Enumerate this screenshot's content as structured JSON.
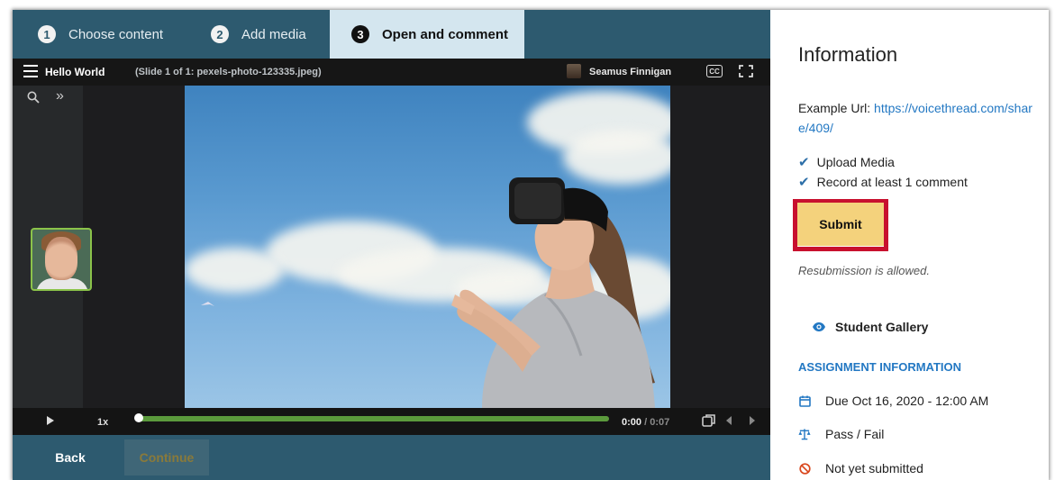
{
  "steps": [
    {
      "number": "1",
      "label": "Choose content"
    },
    {
      "number": "2",
      "label": "Add media"
    },
    {
      "number": "3",
      "label": "Open and comment"
    }
  ],
  "player": {
    "title": "Hello World",
    "slide_info": "(Slide 1 of 1: pexels-photo-123335.jpeg)",
    "owner_name": "Seamus Finnigan",
    "cc_label": "CC",
    "speed": "1x",
    "time_current": "0:00",
    "time_total": "/ 0:07",
    "progress": 1.0
  },
  "nav": {
    "back_label": "Back",
    "continue_label": "Continue"
  },
  "info": {
    "title": "Information",
    "url_label": "Example Url:",
    "url": "https://voicethread.com/share/409/",
    "requirements": [
      "Upload Media",
      "Record at least 1 comment"
    ],
    "submit_label": "Submit",
    "resubmission": "Resubmission is allowed.",
    "gallery_label": "Student Gallery",
    "assignment_heading": "ASSIGNMENT INFORMATION",
    "due": "Due Oct 16, 2020 - 12:00 AM",
    "grading": "Pass / Fail",
    "status": "Not yet submitted"
  },
  "colors": {
    "header_bg": "#2d5a6f",
    "active_step_bg": "#d4e6ef",
    "link": "#2378c3",
    "submit_bg": "#f4d27c",
    "highlight": "#c8102e",
    "progress": "#5b9a3c"
  },
  "icons": {
    "menu": "hamburger-icon",
    "zoom": "search-icon",
    "expand": "double-chevron-right-icon",
    "fullscreen": "fullscreen-icon",
    "play": "play-icon",
    "copy": "copy-icon",
    "check": "checkmark-icon",
    "gallery": "eye-icon",
    "due": "calendar-icon",
    "grading": "scale-icon",
    "status": "no-entry-icon"
  }
}
